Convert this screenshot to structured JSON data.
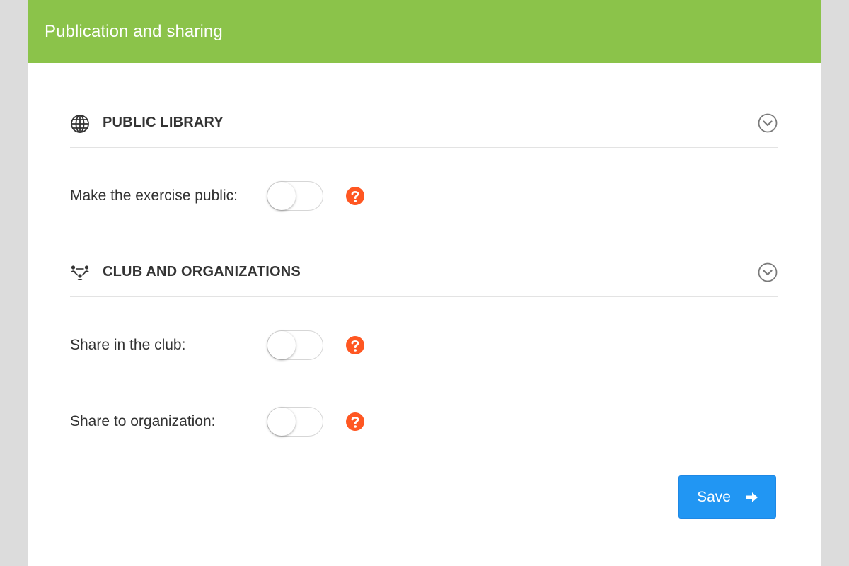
{
  "header": {
    "title": "Publication and sharing"
  },
  "sections": [
    {
      "title": "PUBLIC LIBRARY",
      "icon": "globe-icon",
      "settings": [
        {
          "label": "Make the exercise public:",
          "enabled": false,
          "help_icon": "question-circle-icon"
        }
      ]
    },
    {
      "title": "CLUB AND ORGANIZATIONS",
      "icon": "network-people-icon",
      "settings": [
        {
          "label": "Share in the club:",
          "enabled": false,
          "help_icon": "question-circle-icon"
        },
        {
          "label": "Share to organization:",
          "enabled": false,
          "help_icon": "question-circle-icon"
        }
      ]
    }
  ],
  "actions": {
    "save_label": "Save",
    "save_icon": "arrow-right-icon"
  },
  "colors": {
    "header_bg": "#8bc34a",
    "help_icon": "#ff5722",
    "primary_button": "#2196f3",
    "text": "#333333"
  }
}
